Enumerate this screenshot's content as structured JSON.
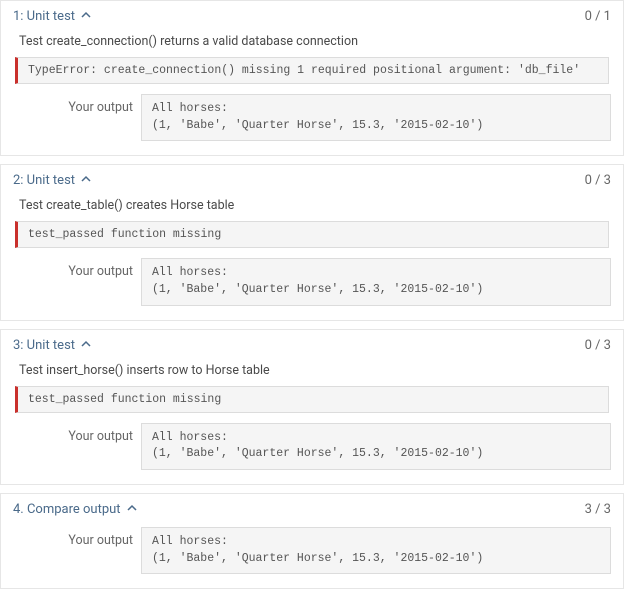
{
  "labels": {
    "your_output": "Your output"
  },
  "tests": [
    {
      "title": "1: Unit test",
      "score": "0 / 1",
      "desc": "Test create_connection() returns a valid database connection",
      "error": "TypeError: create_connection() missing 1 required positional argument: 'db_file'",
      "output": "All horses:\n(1, 'Babe', 'Quarter Horse', 15.3, '2015-02-10')"
    },
    {
      "title": "2: Unit test",
      "score": "0 / 3",
      "desc": "Test create_table() creates Horse table",
      "error": "test_passed function missing",
      "output": "All horses:\n(1, 'Babe', 'Quarter Horse', 15.3, '2015-02-10')"
    },
    {
      "title": "3: Unit test",
      "score": "0 / 3",
      "desc": "Test insert_horse() inserts row to Horse table",
      "error": "test_passed function missing",
      "output": "All horses:\n(1, 'Babe', 'Quarter Horse', 15.3, '2015-02-10')"
    },
    {
      "title": "4. Compare output",
      "score": "3 / 3",
      "desc": null,
      "error": null,
      "output": "All horses:\n(1, 'Babe', 'Quarter Horse', 15.3, '2015-02-10')"
    }
  ]
}
